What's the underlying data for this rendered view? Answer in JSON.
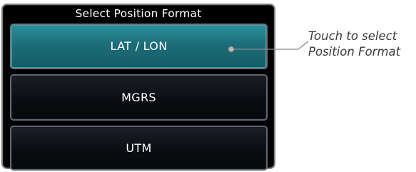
{
  "dialog": {
    "title": "Select Position Format",
    "options": [
      {
        "label": "LAT / LON",
        "selected": true
      },
      {
        "label": "MGRS",
        "selected": false
      },
      {
        "label": "UTM",
        "selected": false
      }
    ]
  },
  "callout": {
    "line1": "Touch to select",
    "line2": "Position Format"
  },
  "colors": {
    "selected_fill": "#1d6d79",
    "normal_fill": "#0b0d12",
    "frame": "#7d7d7d"
  }
}
